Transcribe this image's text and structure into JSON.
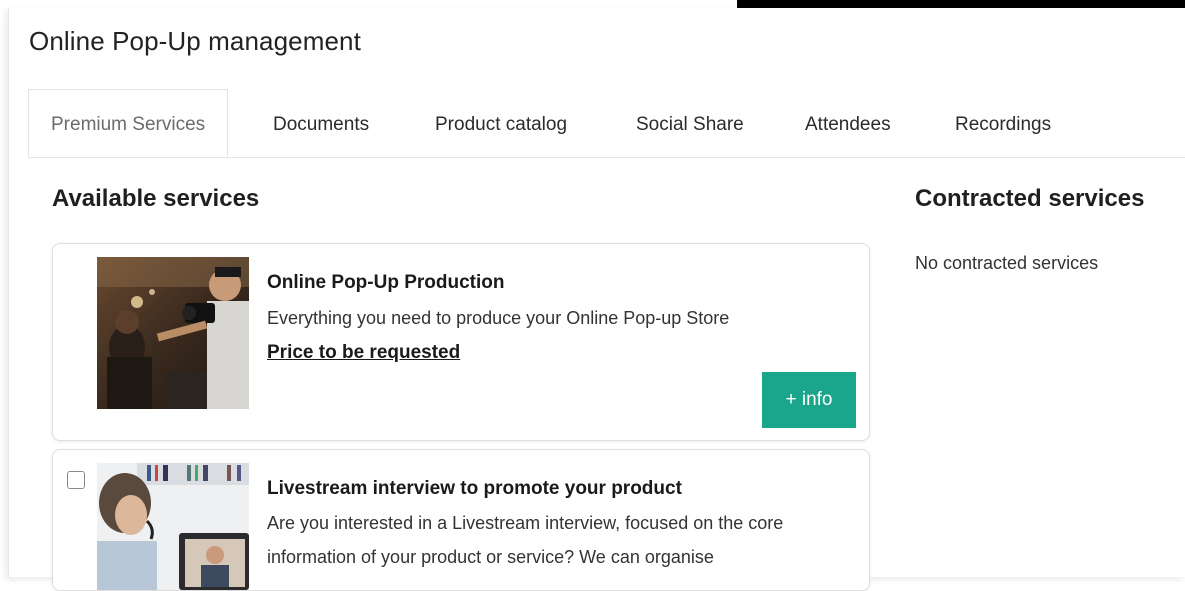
{
  "page": {
    "title": "Online Pop-Up management"
  },
  "tabs": [
    {
      "label": "Premium Services",
      "active": true
    },
    {
      "label": "Documents",
      "active": false
    },
    {
      "label": "Product catalog",
      "active": false
    },
    {
      "label": "Social Share",
      "active": false
    },
    {
      "label": "Attendees",
      "active": false
    },
    {
      "label": "Recordings",
      "active": false
    }
  ],
  "available": {
    "heading": "Available services",
    "services": [
      {
        "title": "Online Pop-Up Production",
        "description": "Everything you need to produce your Online Pop-up Store",
        "price": "Price to be requested",
        "button": "+ info"
      },
      {
        "title": "Livestream interview to promote your product",
        "description": "Are you interested in a Livestream interview, focused on the core information of your product or service? We can organise"
      }
    ]
  },
  "contracted": {
    "heading": "Contracted services",
    "empty_text": "No contracted services"
  },
  "colors": {
    "accent": "#1aa68a"
  }
}
